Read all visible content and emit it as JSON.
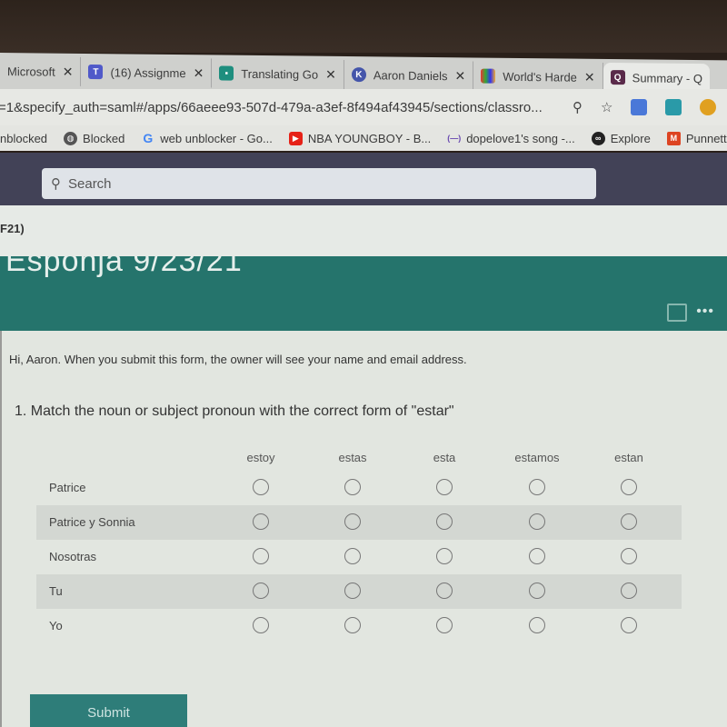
{
  "browser": {
    "tabs": [
      {
        "label": "Microsoft",
        "icon": "microsoft-icon",
        "active": false
      },
      {
        "label": "(16) Assignme",
        "icon": "teams-icon",
        "active": true
      },
      {
        "label": "Translating Go",
        "icon": "classroom-icon",
        "active": false
      },
      {
        "label": "Aaron Daniels",
        "icon": "k-icon",
        "active": false
      },
      {
        "label": "World's Harde",
        "icon": "game-icon",
        "active": false
      },
      {
        "label": "Summary - Q",
        "icon": "forms-icon",
        "active": false
      }
    ],
    "url": "=1&specify_auth=saml#/apps/66aeee93-507d-479a-a3ef-8f494af43945/sections/classro...",
    "bookmarks": [
      {
        "label": "nblocked",
        "icon": ""
      },
      {
        "label": "Blocked",
        "icon": "globe-icon"
      },
      {
        "label": "web unblocker - Go...",
        "icon": "google-icon"
      },
      {
        "label": "NBA YOUNGBOY - B...",
        "icon": "youtube-icon"
      },
      {
        "label": "dopelove1's song -...",
        "icon": "soundcloud-icon"
      },
      {
        "label": "Explore",
        "icon": "explore-icon"
      },
      {
        "label": "Punnett Squa",
        "icon": "m-icon"
      }
    ]
  },
  "app": {
    "search_placeholder": "Search",
    "breadcrumb_fragment": "F21)",
    "form_title": "Esponja 9/23/21",
    "notice": "Hi, Aaron. When you submit this form, the owner will see your name and email address.",
    "question": {
      "number": "1.",
      "text": "Match the noun or subject pronoun with the correct form of \"estar\"",
      "columns": [
        "estoy",
        "estas",
        "esta",
        "estamos",
        "estan"
      ],
      "rows": [
        "Patrice",
        "Patrice y Sonnia",
        "Nosotras",
        "Tu",
        "Yo"
      ],
      "selected": [
        null,
        null,
        null,
        null,
        null
      ]
    },
    "submit_label": "Submit"
  },
  "colors": {
    "header_bg": "#424257",
    "banner_bg": "#25746c",
    "submit_bg": "#2e7d79"
  }
}
